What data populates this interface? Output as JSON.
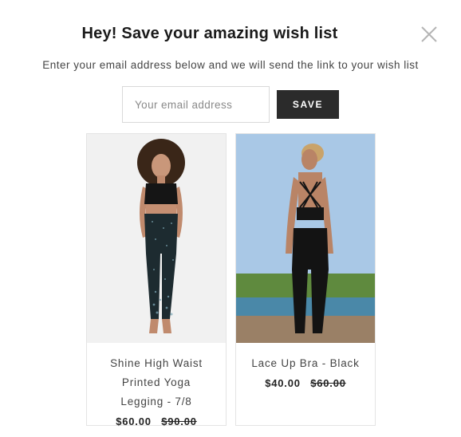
{
  "modal": {
    "title": "Hey! Save your amazing wish list",
    "subtitle": "Enter your email address below and we will send the link to your wish list",
    "close_icon": "close-icon"
  },
  "form": {
    "email_placeholder": "Your email address",
    "email_value": "",
    "save_label": "SAVE",
    "button_color": "#2b2b2b"
  },
  "products": [
    {
      "name": "Shine High Waist Printed Yoga Legging - 7/8",
      "price": "$60.00",
      "compare_price": "$90.00",
      "image": "woman in black crop top and speckled leggings"
    },
    {
      "name": "Lace Up Bra - Black",
      "price": "$40.00",
      "compare_price": "$60.00",
      "image": "woman in lace-up bra and black leggings by the sea"
    }
  ]
}
